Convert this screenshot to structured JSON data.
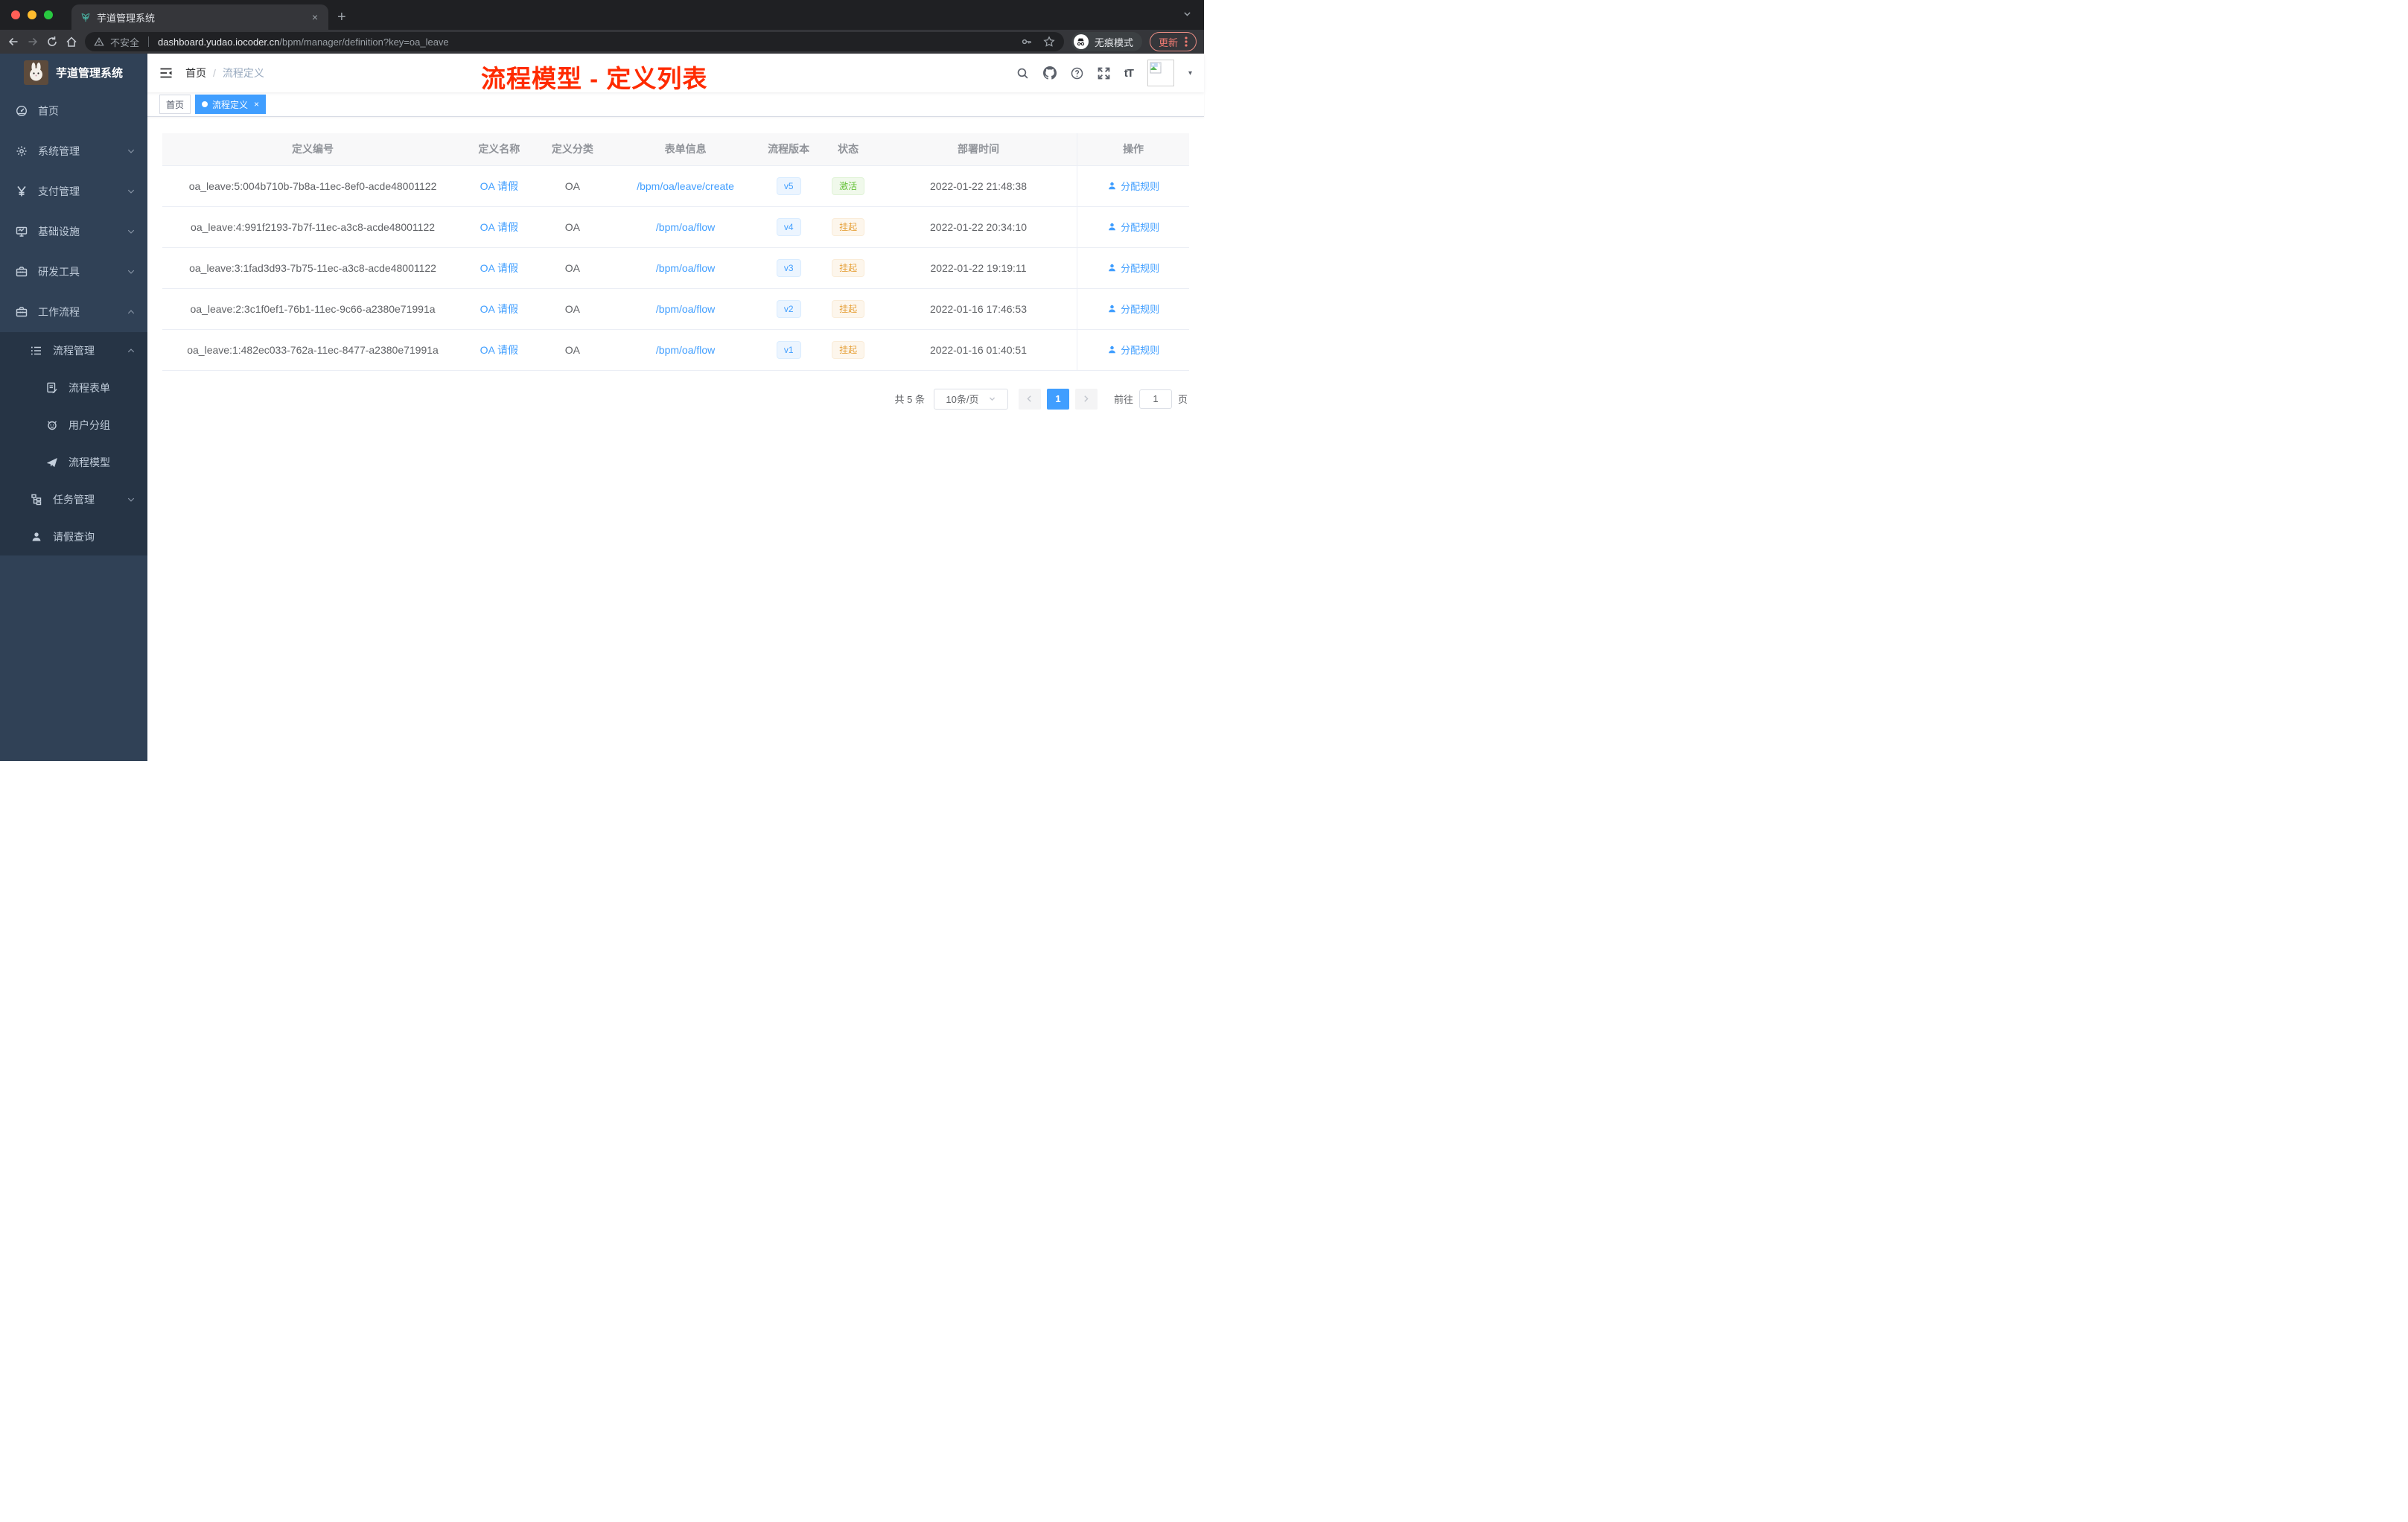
{
  "browser": {
    "tab_title": "芋道管理系统",
    "security_label": "不安全",
    "url_host": "dashboard.yudao.iocoder.cn",
    "url_path": "/bpm/manager/definition?key=oa_leave",
    "incognito_label": "无痕模式",
    "update_label": "更新"
  },
  "sidebar": {
    "title": "芋道管理系统",
    "items": [
      {
        "key": "home",
        "label": "首页",
        "icon": "dashboard-icon",
        "level": 1
      },
      {
        "key": "system",
        "label": "系统管理",
        "icon": "gear-icon",
        "level": 1,
        "chevron": "down"
      },
      {
        "key": "payment",
        "label": "支付管理",
        "icon": "yen-icon",
        "level": 1,
        "chevron": "down"
      },
      {
        "key": "infra",
        "label": "基础设施",
        "icon": "monitor-icon",
        "level": 1,
        "chevron": "down"
      },
      {
        "key": "devtools",
        "label": "研发工具",
        "icon": "toolbox-icon",
        "level": 1,
        "chevron": "down"
      },
      {
        "key": "workflow",
        "label": "工作流程",
        "icon": "briefcase-icon",
        "level": 1,
        "chevron": "up"
      },
      {
        "key": "process-mgmt",
        "label": "流程管理",
        "icon": "list-tree-icon",
        "level": 2,
        "chevron": "up"
      },
      {
        "key": "process-form",
        "label": "流程表单",
        "icon": "form-edit-icon",
        "level": 3
      },
      {
        "key": "user-group",
        "label": "用户分组",
        "icon": "robot-icon",
        "level": 3
      },
      {
        "key": "process-model",
        "label": "流程模型",
        "icon": "paper-plane-icon",
        "level": 3
      },
      {
        "key": "task-mgmt",
        "label": "任务管理",
        "icon": "org-tree-icon",
        "level": 2,
        "chevron": "down"
      },
      {
        "key": "leave-query",
        "label": "请假查询",
        "icon": "user-icon",
        "level": 2
      }
    ]
  },
  "header": {
    "breadcrumb_home": "首页",
    "breadcrumb_current": "流程定义",
    "annotation": "流程模型 - 定义列表"
  },
  "tags": {
    "home": "首页",
    "active": "流程定义"
  },
  "table": {
    "columns": [
      "定义编号",
      "定义名称",
      "定义分类",
      "表单信息",
      "流程版本",
      "状态",
      "部署时间",
      "操作"
    ],
    "rows": [
      {
        "id": "oa_leave:5:004b710b-7b8a-11ec-8ef0-acde48001122",
        "name": "OA 请假",
        "category": "OA",
        "form": "/bpm/oa/leave/create",
        "version": "v5",
        "status": "激活",
        "status_type": "success",
        "time": "2022-01-22 21:48:38",
        "action": "分配规则"
      },
      {
        "id": "oa_leave:4:991f2193-7b7f-11ec-a3c8-acde48001122",
        "name": "OA 请假",
        "category": "OA",
        "form": "/bpm/oa/flow",
        "version": "v4",
        "status": "挂起",
        "status_type": "warning",
        "time": "2022-01-22 20:34:10",
        "action": "分配规则"
      },
      {
        "id": "oa_leave:3:1fad3d93-7b75-11ec-a3c8-acde48001122",
        "name": "OA 请假",
        "category": "OA",
        "form": "/bpm/oa/flow",
        "version": "v3",
        "status": "挂起",
        "status_type": "warning",
        "time": "2022-01-22 19:19:11",
        "action": "分配规则"
      },
      {
        "id": "oa_leave:2:3c1f0ef1-76b1-11ec-9c66-a2380e71991a",
        "name": "OA 请假",
        "category": "OA",
        "form": "/bpm/oa/flow",
        "version": "v2",
        "status": "挂起",
        "status_type": "warning",
        "time": "2022-01-16 17:46:53",
        "action": "分配规则"
      },
      {
        "id": "oa_leave:1:482ec033-762a-11ec-8477-a2380e71991a",
        "name": "OA 请假",
        "category": "OA",
        "form": "/bpm/oa/flow",
        "version": "v1",
        "status": "挂起",
        "status_type": "warning",
        "time": "2022-01-16 01:40:51",
        "action": "分配规则"
      }
    ]
  },
  "pagination": {
    "total": "共 5 条",
    "size": "10条/页",
    "page": "1",
    "goto": "前往",
    "goto_value": "1",
    "unit": "页"
  },
  "colors": {
    "accent": "#409eff",
    "success": "#67c23a",
    "warning": "#e6a23c",
    "annotation_red": "#ff2b00",
    "sidebar_bg": "#304156",
    "sidebar_sub_bg": "#263445",
    "table_header_bg": "#f8f8f9"
  }
}
